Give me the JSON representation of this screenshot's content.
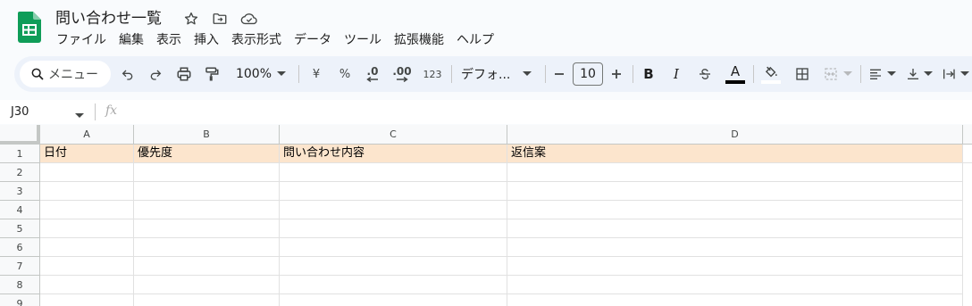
{
  "doc": {
    "title": "問い合わせ一覧"
  },
  "menu": [
    "ファイル",
    "編集",
    "表示",
    "挿入",
    "表示形式",
    "データ",
    "ツール",
    "拡張機能",
    "ヘルプ"
  ],
  "toolbar": {
    "search_label": "メニュー",
    "zoom": "100%",
    "currency": "¥",
    "percent": "%",
    "decimal_decrease": ".0",
    "decimal_increase": ".00",
    "number_format": "123",
    "font": "デフォ...",
    "font_size": "10",
    "bold": "B",
    "italic": "I",
    "text_color_letter": "A",
    "colors": {
      "brand_green": "#0f9d58",
      "toolbar_bg": "#edf2fa",
      "text_color_bar": "#000000"
    }
  },
  "formula_bar": {
    "name_box": "J30",
    "fx": "fx"
  },
  "grid": {
    "columns": [
      "A",
      "B",
      "C",
      "D"
    ],
    "rows": [
      "1",
      "2",
      "3",
      "4",
      "5",
      "6",
      "7",
      "8",
      "9"
    ],
    "header_row": [
      "日付",
      "優先度",
      "問い合わせ内容",
      "返信案"
    ],
    "header_fill": "#fce5cd"
  },
  "icons": {
    "title": [
      "star-icon",
      "move-to-folder-icon",
      "cloud-saved-icon"
    ],
    "toolbar": [
      "search-icon",
      "undo-icon",
      "redo-icon",
      "print-icon",
      "paint-format-icon",
      "fill-color-icon",
      "borders-icon",
      "merge-cells-icon",
      "align-left-icon",
      "valign-bottom-icon",
      "text-wrap-icon"
    ]
  }
}
